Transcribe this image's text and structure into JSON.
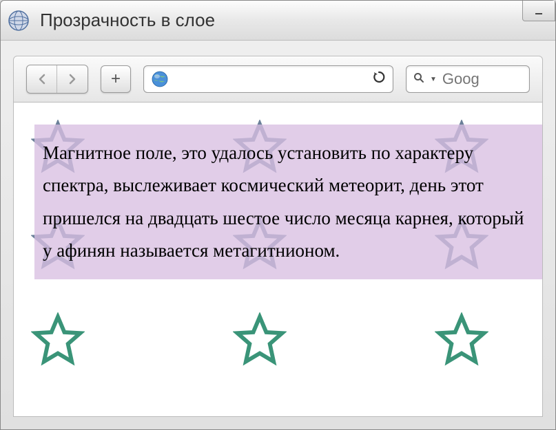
{
  "window": {
    "title": "Прозрачность в слое"
  },
  "toolbar": {
    "nav_back": "◄",
    "nav_forward": "►",
    "new_tab": "+",
    "reload": "↻"
  },
  "search": {
    "placeholder": "Goog"
  },
  "content": {
    "text": "Магнитное поле, это удалось установить по характеру спектра, выслеживает космический метеорит, день этот пришелся на двадцать шестое число месяца карнея, который у афинян называется метагитнионом."
  },
  "stars": {
    "rows": [
      {
        "color": "#6b8099"
      },
      {
        "color": "#6b8099"
      },
      {
        "color": "#3a9478"
      }
    ]
  }
}
